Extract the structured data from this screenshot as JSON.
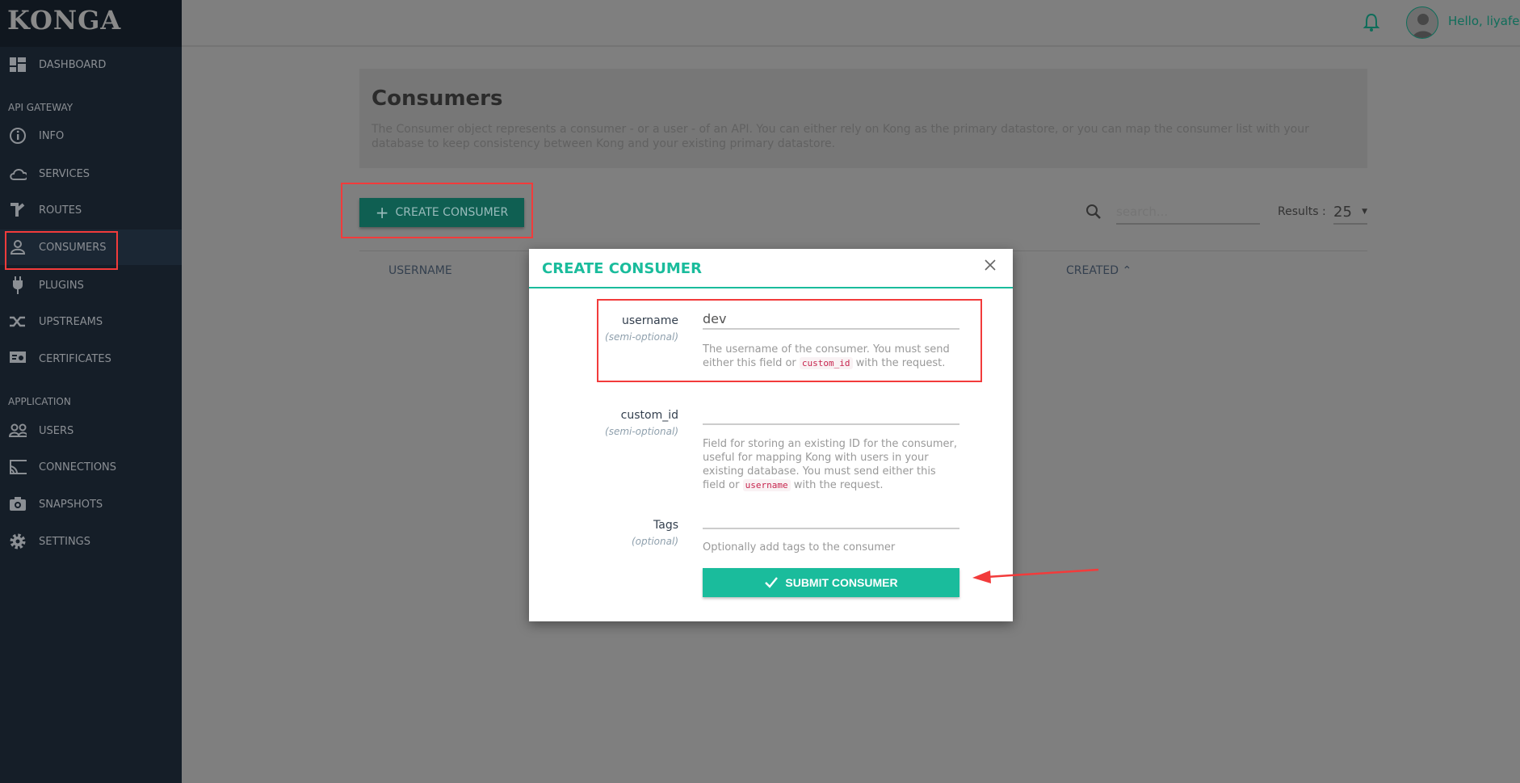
{
  "app": {
    "logo": "KONGA"
  },
  "sidebar": {
    "dashboard": "DASHBOARD",
    "sections": [
      "API GATEWAY",
      "APPLICATION"
    ],
    "gateway_items": [
      {
        "label": "INFO",
        "icon": "info-icon"
      },
      {
        "label": "SERVICES",
        "icon": "cloud-icon"
      },
      {
        "label": "ROUTES",
        "icon": "routes-icon"
      },
      {
        "label": "CONSUMERS",
        "icon": "user-icon",
        "active": true
      },
      {
        "label": "PLUGINS",
        "icon": "plug-icon"
      },
      {
        "label": "UPSTREAMS",
        "icon": "shuffle-icon"
      },
      {
        "label": "CERTIFICATES",
        "icon": "certificate-icon"
      }
    ],
    "app_items": [
      {
        "label": "USERS",
        "icon": "users-icon"
      },
      {
        "label": "CONNECTIONS",
        "icon": "cast-icon"
      },
      {
        "label": "SNAPSHOTS",
        "icon": "camera-icon"
      },
      {
        "label": "SETTINGS",
        "icon": "gear-icon"
      }
    ]
  },
  "header": {
    "greeting": "Hello, liyafei"
  },
  "page": {
    "title": "Consumers",
    "description": "The Consumer object represents a consumer - or a user - of an API. You can either rely on Kong as the primary datastore, or you can map the consumer list with your database to keep consistency between Kong and your existing primary datastore.",
    "create_button": "CREATE CONSUMER",
    "search_placeholder": "search...",
    "results_label": "Results :",
    "results_value": "25",
    "columns": [
      "USERNAME",
      "CREATED"
    ]
  },
  "modal": {
    "title": "CREATE CONSUMER",
    "fields": [
      {
        "label": "username",
        "note": "(semi-optional)",
        "value": "dev",
        "help_pre": "The username of the consumer. You must send either this field or ",
        "help_code": "custom_id",
        "help_post": " with the request."
      },
      {
        "label": "custom_id",
        "note": "(semi-optional)",
        "value": "",
        "help_pre": "Field for storing an existing ID for the consumer, useful for mapping Kong with users in your existing database. You must send either this field or ",
        "help_code": "username",
        "help_post": " with the request."
      },
      {
        "label": "Tags",
        "note": "(optional)",
        "value": "",
        "help_pre": "Optionally add tags to the consumer"
      }
    ],
    "submit": "SUBMIT CONSUMER"
  },
  "colors": {
    "accent": "#1abc9c",
    "annotation": "#f23b3b"
  }
}
